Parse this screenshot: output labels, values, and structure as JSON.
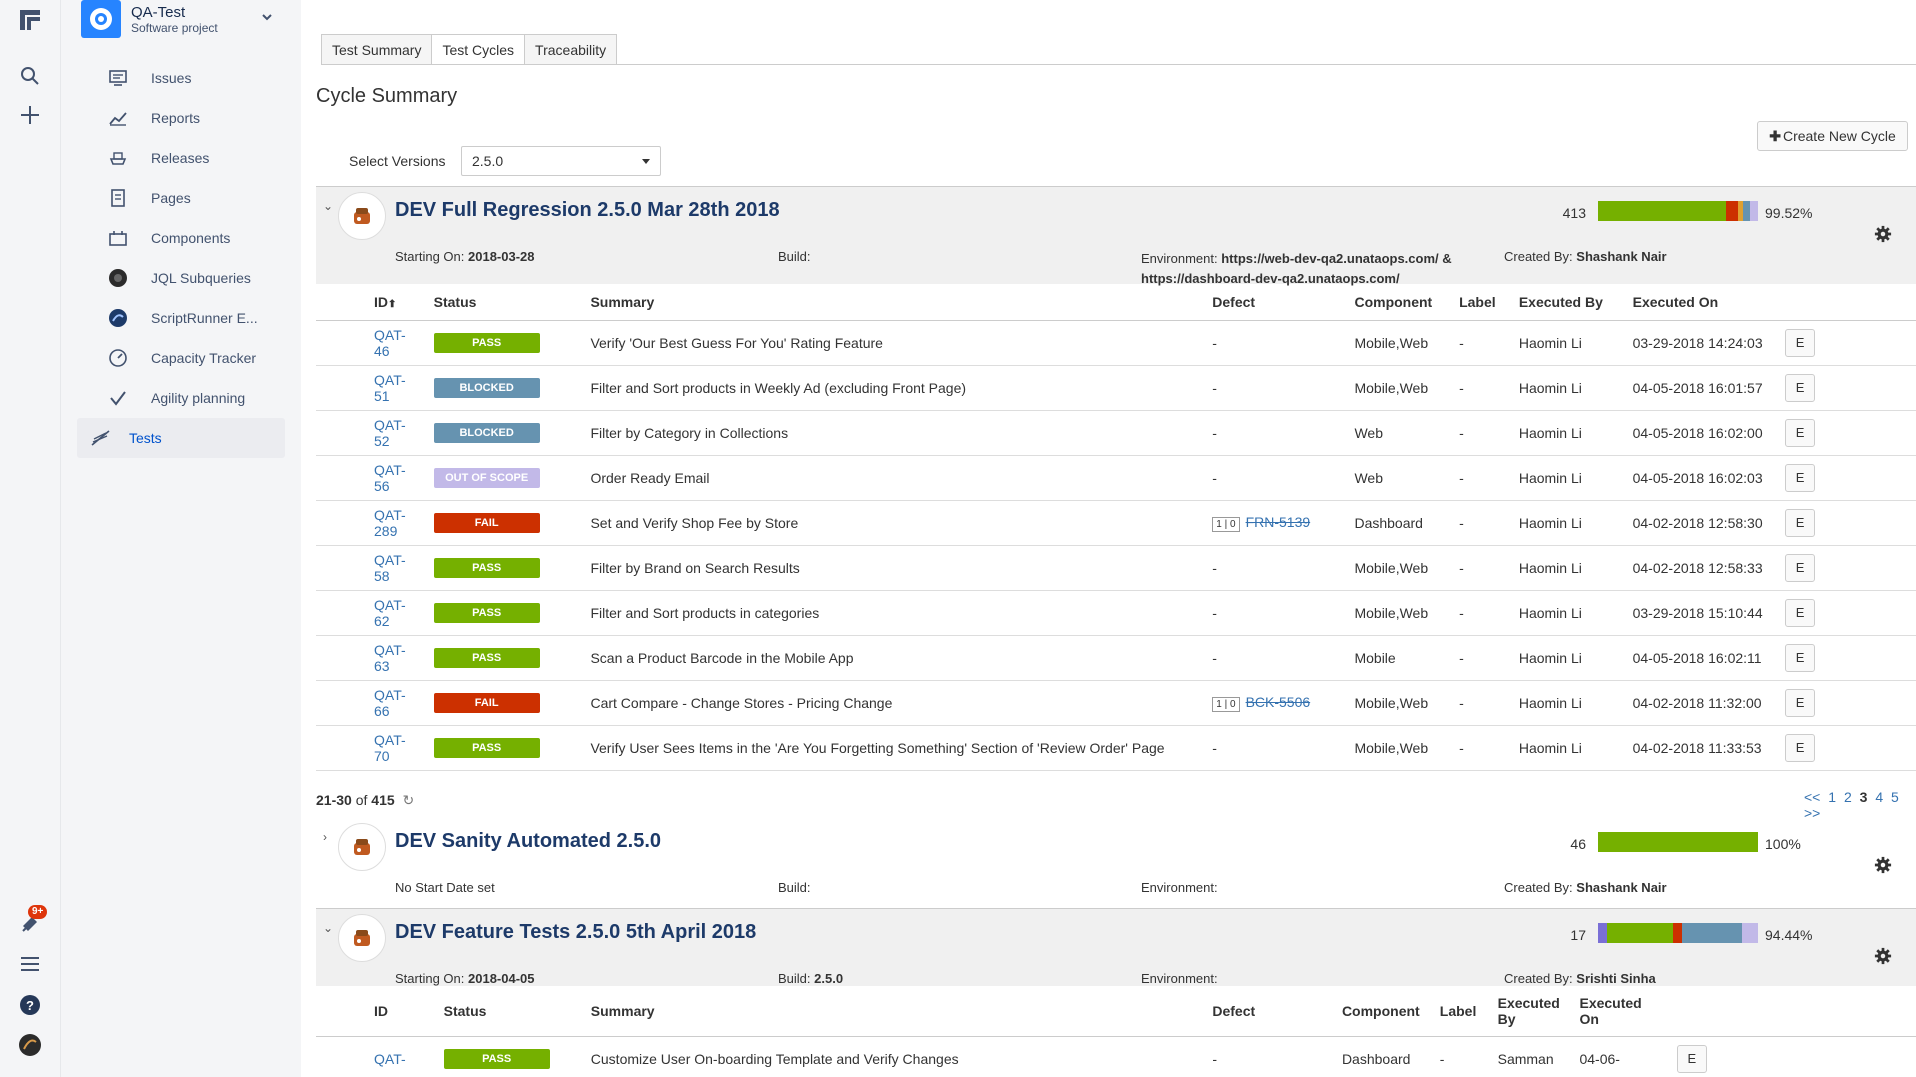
{
  "project": {
    "name": "QA-Test",
    "type": "Software project"
  },
  "nav": [
    {
      "label": "Issues",
      "icon": "issues-icon"
    },
    {
      "label": "Reports",
      "icon": "reports-icon"
    },
    {
      "label": "Releases",
      "icon": "releases-icon"
    },
    {
      "label": "Pages",
      "icon": "pages-icon"
    },
    {
      "label": "Components",
      "icon": "components-icon"
    },
    {
      "label": "JQL Subqueries",
      "icon": "jql-icon"
    },
    {
      "label": "ScriptRunner E...",
      "icon": "scriptrunner-icon"
    },
    {
      "label": "Capacity Tracker",
      "icon": "capacity-icon"
    },
    {
      "label": "Agility planning",
      "icon": "check-icon"
    },
    {
      "label": "Tests",
      "icon": "tests-icon"
    }
  ],
  "notification_badge": "9+",
  "tabs": [
    "Test Summary",
    "Test Cycles",
    "Traceability"
  ],
  "page_title": "Cycle Summary",
  "create_button": "Create New Cycle",
  "versions": {
    "label": "Select Versions",
    "value": "2.5.0"
  },
  "columns": [
    "ID",
    "Status",
    "Summary",
    "Defect",
    "Component",
    "Label",
    "Executed By",
    "Executed On"
  ],
  "status_colors": {
    "PASS": "#75b000",
    "BLOCKED": "#6693b0",
    "OUT OF SCOPE": "#c2b9e8",
    "FAIL": "#cc3000"
  },
  "cycle1": {
    "name": "DEV Full Regression 2.5.0 Mar 28th 2018",
    "count": "413",
    "percent": "99.52%",
    "starting_label": "Starting On:",
    "starting_value": "2018-03-28",
    "build_label": "Build:",
    "build_value": "",
    "env_label": "Environment:",
    "env_value": "https://web-dev-qa2.unataops.com/ & https://dashboard-dev-qa2.unataops.com/",
    "created_label": "Created By:",
    "created_value": "Shashank Nair",
    "rows": [
      {
        "id": "QAT-46",
        "status": "PASS",
        "summary": "Verify 'Our Best Guess For You' Rating Feature",
        "defect": "-",
        "defect_count": "",
        "component": "Mobile,Web",
        "label": "-",
        "by": "Haomin Li",
        "on": "03-29-2018 14:24:03"
      },
      {
        "id": "QAT-51",
        "status": "BLOCKED",
        "summary": "Filter and Sort products in Weekly Ad (excluding Front Page)",
        "defect": "-",
        "defect_count": "",
        "component": "Mobile,Web",
        "label": "-",
        "by": "Haomin Li",
        "on": "04-05-2018 16:01:57"
      },
      {
        "id": "QAT-52",
        "status": "BLOCKED",
        "summary": "Filter by Category in Collections",
        "defect": "-",
        "defect_count": "",
        "component": "Web",
        "label": "-",
        "by": "Haomin Li",
        "on": "04-05-2018 16:02:00"
      },
      {
        "id": "QAT-56",
        "status": "OUT OF SCOPE",
        "summary": "Order Ready Email",
        "defect": "-",
        "defect_count": "",
        "component": "Web",
        "label": "-",
        "by": "Haomin Li",
        "on": "04-05-2018 16:02:03"
      },
      {
        "id": "QAT-289",
        "status": "FAIL",
        "summary": "Set and Verify Shop Fee by Store",
        "defect": "FRN-5139",
        "defect_count": "1 | 0",
        "component": "Dashboard",
        "label": "-",
        "by": "Haomin Li",
        "on": "04-02-2018 12:58:30"
      },
      {
        "id": "QAT-58",
        "status": "PASS",
        "summary": "Filter by Brand on Search Results",
        "defect": "-",
        "defect_count": "",
        "component": "Mobile,Web",
        "label": "-",
        "by": "Haomin Li",
        "on": "04-02-2018 12:58:33"
      },
      {
        "id": "QAT-62",
        "status": "PASS",
        "summary": "Filter and Sort products in categories",
        "defect": "-",
        "defect_count": "",
        "component": "Mobile,Web",
        "label": "-",
        "by": "Haomin Li",
        "on": "03-29-2018 15:10:44"
      },
      {
        "id": "QAT-63",
        "status": "PASS",
        "summary": "Scan a Product Barcode in the Mobile App",
        "defect": "-",
        "defect_count": "",
        "component": "Mobile",
        "label": "-",
        "by": "Haomin Li",
        "on": "04-05-2018 16:02:11"
      },
      {
        "id": "QAT-66",
        "status": "FAIL",
        "summary": "Cart Compare - Change Stores - Pricing Change",
        "defect": "BCK-5506",
        "defect_count": "1 | 0",
        "component": "Mobile,Web",
        "label": "-",
        "by": "Haomin Li",
        "on": "04-02-2018 11:32:00"
      },
      {
        "id": "QAT-70",
        "status": "PASS",
        "summary": "Verify User Sees Items in the 'Are You Forgetting Something' Section of 'Review Order' Page",
        "defect": "-",
        "defect_count": "",
        "component": "Mobile,Web",
        "label": "-",
        "by": "Haomin Li",
        "on": "04-02-2018 11:33:53"
      }
    ],
    "range": "21-30",
    "of_label": "of",
    "total": "415",
    "pager": [
      "<<",
      "1",
      "2",
      "3",
      "4",
      "5",
      ">>"
    ]
  },
  "cycle2": {
    "name": "DEV Sanity Automated 2.5.0",
    "count": "46",
    "percent": "100%",
    "starting_text": "No Start Date set",
    "build_label": "Build:",
    "env_label": "Environment:",
    "created_label": "Created By:",
    "created_value": "Shashank Nair"
  },
  "cycle3": {
    "name": "DEV Feature Tests 2.5.0 5th April 2018",
    "count": "17",
    "percent": "94.44%",
    "starting_label": "Starting On:",
    "starting_value": "2018-04-05",
    "build_label": "Build:",
    "build_value": "2.5.0",
    "env_label": "Environment:",
    "created_label": "Created By:",
    "created_value": "Srishti Sinha",
    "row": {
      "id": "QAT-",
      "status": "PASS",
      "summary": "Customize User On-boarding Template and Verify Changes",
      "defect": "-",
      "component": "Dashboard",
      "label": "-",
      "by": "Samman",
      "on": "04-06-"
    }
  },
  "edit_label": "E"
}
